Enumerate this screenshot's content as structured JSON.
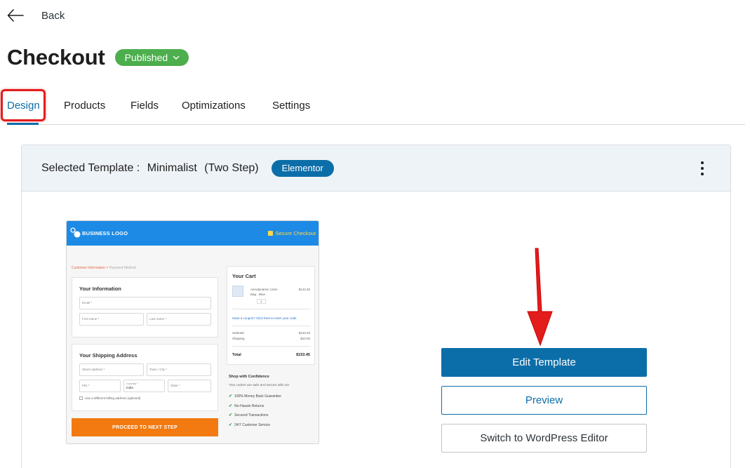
{
  "nav": {
    "back_label": "Back"
  },
  "page": {
    "title": "Checkout",
    "status": "Published"
  },
  "tabs": [
    "Design",
    "Products",
    "Fields",
    "Optimizations",
    "Settings"
  ],
  "template_header": {
    "label": "Selected Template :",
    "name": "Minimalist",
    "variant": "(Two Step)",
    "builder": "Elementor"
  },
  "preview": {
    "logo": "BUSINESS LOGO",
    "secure": "Secure Checkout",
    "breadcrumb_active": "Customer Information",
    "breadcrumb_sep": ">",
    "breadcrumb_next": "Payment Method",
    "info_heading": "Your Information",
    "email": "Email *",
    "first_name": "First name *",
    "last_name": "Last name *",
    "shipping_heading": "Your Shipping Address",
    "street": "Street address *",
    "town": "Town / City *",
    "pin": "PIN *",
    "country_label": "Country *",
    "country_value": "India",
    "state": "State *",
    "different_billing": "Use a different billing address (optional)",
    "proceed": "PROCEED TO NEXT STEP",
    "cart_heading": "Your Cart",
    "product_name": "Aerodynamic Linen",
    "product_variant": "Bag - Blue",
    "product_price": "$143.45",
    "qty": "1",
    "coupon": "Have a coupon? Click here to enter your code",
    "subtotal_label": "Subtotal",
    "subtotal_value": "$143.45",
    "shipping_label": "Shipping",
    "shipping_value": "$10.00",
    "total_label": "Total",
    "total_value": "$153.45",
    "confidence_heading": "Shop with Confidence",
    "confidence_sub": "Your orders are safe and secure with us!",
    "guarantees": [
      "100% Money Back Guarantee",
      "No-Hassle Returns",
      "Secured Transactions",
      "24/7 Customer Service"
    ]
  },
  "actions": {
    "edit": "Edit Template",
    "preview": "Preview",
    "switch": "Switch to WordPress Editor"
  },
  "colors": {
    "accent": "#0c6ea8",
    "published": "#4cae4c",
    "highlight": "#e31c1c",
    "proceed": "#f27a10",
    "preview_header": "#1d8be6"
  }
}
